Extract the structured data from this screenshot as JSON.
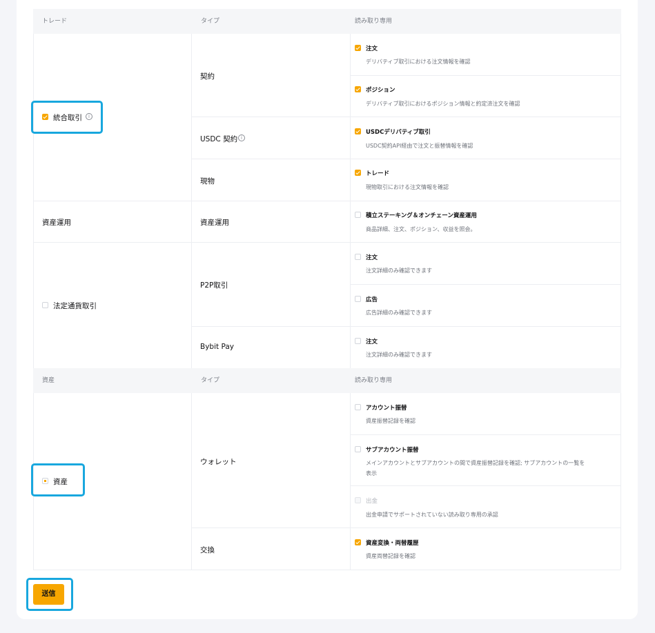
{
  "colors": {
    "accent": "#f7a600",
    "highlight": "#18a7de"
  },
  "trade_header": {
    "col1": "トレード",
    "col2": "タイプ",
    "col3": "読み取り専用"
  },
  "asset_header": {
    "col1": "資産",
    "col2": "タイプ",
    "col3": "読み取り専用"
  },
  "groups": {
    "unified": {
      "label": "統合取引",
      "checked": true
    },
    "earn": {
      "label": "資産運用"
    },
    "fiat": {
      "label": "法定通貨取引",
      "checked": false
    },
    "assets": {
      "label": "資産",
      "state": "partial"
    }
  },
  "types": {
    "contract": "契約",
    "usdc_contract": "USDC 契約",
    "spot": "現物",
    "earn": "資産運用",
    "p2p": "P2P取引",
    "bybit_pay": "Bybit Pay",
    "wallet": "ウォレット",
    "exchange": "交換"
  },
  "perms": {
    "contract_order": {
      "title": "注文",
      "desc": "デリバティブ取引における注文情報を確認",
      "checked": true
    },
    "contract_position": {
      "title": "ポジション",
      "desc": "デリバティブ取引におけるポジション情報と約定済注文を確認",
      "checked": true
    },
    "usdc_derivatives": {
      "title": "USDCデリバティブ取引",
      "desc": "USDC契約API経由で注文と振替情報を確認",
      "checked": true
    },
    "spot_trade": {
      "title": "トレード",
      "desc": "現物取引における注文情報を確認",
      "checked": true
    },
    "earn_staking": {
      "title": "積立ステーキング＆オンチェーン資産運用",
      "desc": "商品詳細、注文、ポジション、収益を照会。",
      "checked": false
    },
    "p2p_order": {
      "title": "注文",
      "desc": "注文詳細のみ確認できます",
      "checked": false
    },
    "p2p_ads": {
      "title": "広告",
      "desc": "広告詳細のみ確認できます",
      "checked": false
    },
    "pay_order": {
      "title": "注文",
      "desc": "注文詳細のみ確認できます",
      "checked": false
    },
    "account_transfer": {
      "title": "アカウント振替",
      "desc": "資産振替記録を確認",
      "checked": false
    },
    "sub_transfer": {
      "title": "サブアカウント振替",
      "desc_line1": "メインアカウントとサブアカウントの間で資産振替記録を確認; サブアカウントの一覧を",
      "desc_line2": "表示",
      "checked": false
    },
    "withdrawal": {
      "title": "出金",
      "desc": "出金申請でサポートされていない読み取り専用の承認",
      "checked": false,
      "disabled": true
    },
    "convert_history": {
      "title": "資産変換・両替履歴",
      "desc": "資産両替記録を確認",
      "checked": true
    }
  },
  "submit_label": "送信",
  "icons": {
    "info": "info-circle-icon",
    "check": "checkbox-checked-icon"
  }
}
